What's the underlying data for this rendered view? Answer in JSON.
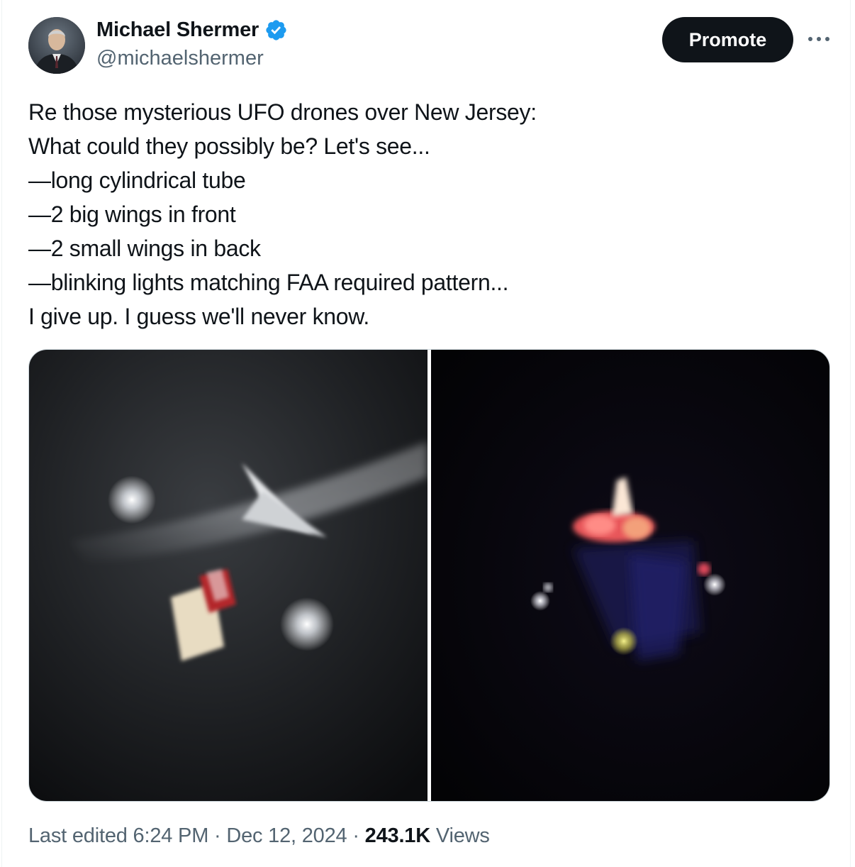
{
  "author": {
    "display_name": "Michael Shermer",
    "handle": "@michaelshermer",
    "verified_icon": "verified-badge-icon",
    "verified_color": "#1d9bf0"
  },
  "actions": {
    "promote_label": "Promote",
    "more_icon": "more-horizontal-icon"
  },
  "tweet": {
    "lines": [
      "Re those mysterious UFO drones over New Jersey:",
      "What could they possibly be? Let's see...",
      "—long cylindrical tube",
      "—2 big wings in front",
      "—2 small wings in back",
      "—blinking lights matching FAA required pattern...",
      "I give up. I guess we'll never know."
    ]
  },
  "media": {
    "count": 2
  },
  "meta": {
    "edited_prefix": "Last edited",
    "time": "6:24 PM",
    "separator": "·",
    "date": "Dec 12, 2024",
    "views_count": "243.1K",
    "views_label": "Views"
  },
  "colors": {
    "text_primary": "#0f1419",
    "text_secondary": "#536471",
    "promote_bg": "#0f1419"
  }
}
